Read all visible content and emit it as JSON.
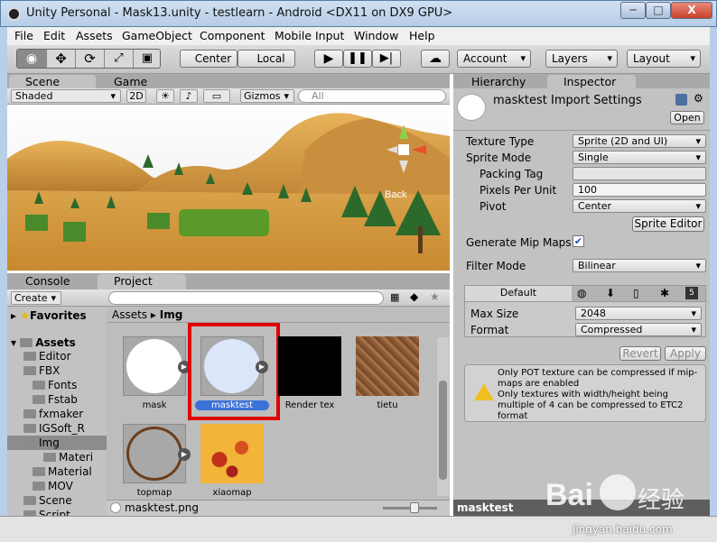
{
  "window": {
    "title": "Unity Personal - Mask13.unity - testlearn - Android <DX11 on DX9 GPU>",
    "min": "─",
    "max": "□",
    "close": "X"
  },
  "menu": [
    "File",
    "Edit",
    "Assets",
    "GameObject",
    "Component",
    "Mobile Input",
    "Window",
    "Help"
  ],
  "toolbar": {
    "center": "Center",
    "local": "Local",
    "account": "Account",
    "layers": "Layers",
    "layout": "Layout"
  },
  "scene_tabs": {
    "scene": "Scene",
    "game": "Game"
  },
  "scene_opts": {
    "shading": "Shaded",
    "mode2d": "2D",
    "gizmos": "Gizmos",
    "search_placeholder": "All",
    "back_label": "Back"
  },
  "project_tabs": {
    "console": "Console",
    "project": "Project",
    "create": "Create"
  },
  "tree": {
    "favorites": "Favorites",
    "assets": "Assets",
    "items": [
      "Editor",
      "FBX",
      "Fonts",
      "Fstab",
      "fxmaker",
      "IGSoft_R",
      "Img",
      "Materi",
      "Material",
      "MOV",
      "Scene",
      "Script"
    ],
    "selected": "Img"
  },
  "breadcrumb": {
    "root": "Assets",
    "sep": "▸",
    "current": "Img"
  },
  "assets": [
    {
      "name": "mask"
    },
    {
      "name": "masktest",
      "selected": true
    },
    {
      "name": "Render tex"
    },
    {
      "name": "tietu"
    },
    {
      "name": "topmap"
    },
    {
      "name": "xiaomap"
    }
  ],
  "status": {
    "file": "masktest.png"
  },
  "inspector": {
    "tabs": {
      "hierarchy": "Hierarchy",
      "inspector": "Inspector"
    },
    "title": "masktest Import Settings",
    "open": "Open",
    "texture_type_label": "Texture Type",
    "texture_type": "Sprite (2D and UI)",
    "sprite_mode_label": "Sprite Mode",
    "sprite_mode": "Single",
    "packing_tag_label": "Packing Tag",
    "packing_tag": "",
    "ppu_label": "Pixels Per Unit",
    "ppu": "100",
    "pivot_label": "Pivot",
    "pivot": "Center",
    "sprite_editor": "Sprite Editor",
    "mipmaps_label": "Generate Mip Maps",
    "mipmaps": true,
    "filter_label": "Filter Mode",
    "filter": "Bilinear",
    "platform_default": "Default",
    "max_size_label": "Max Size",
    "max_size": "2048",
    "format_label": "Format",
    "format": "Compressed",
    "revert": "Revert",
    "apply": "Apply",
    "warning": "Only POT texture can be compressed if mip-maps are enabled\nOnly textures with width/height being multiple of 4 can be compressed to ETC2 format",
    "footer": "masktest"
  },
  "watermark": {
    "brand": "Bai",
    "cn": "经验",
    "url": "jingyan.baidu.com"
  },
  "colors": {
    "selection": "#3a72d8",
    "highlight_box": "#e00000",
    "sky": "#ffffff",
    "sand": "#d59b3f"
  }
}
